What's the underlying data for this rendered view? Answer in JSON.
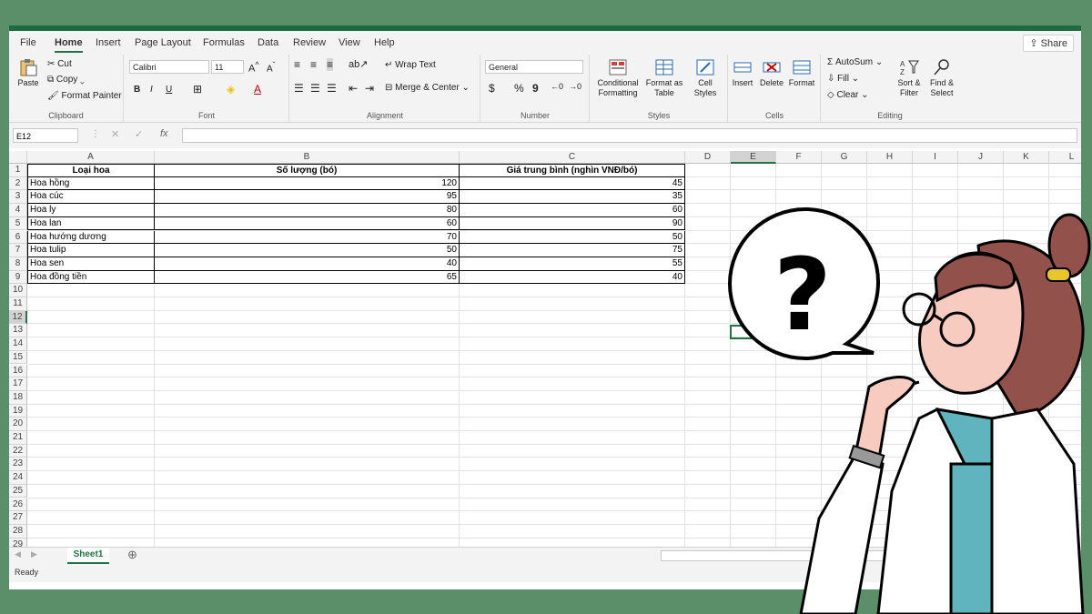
{
  "ribbon_tabs": [
    "File",
    "Home",
    "Insert",
    "Page Layout",
    "Formulas",
    "Data",
    "Review",
    "View",
    "Help"
  ],
  "share_label": "Share",
  "clipboard": {
    "paste": "Paste",
    "cut": "Cut",
    "copy": "Copy",
    "format_painter": "Format Painter",
    "label": "Clipboard"
  },
  "font": {
    "name": "Calibri",
    "size": "11",
    "label": "Font",
    "bold": "B",
    "italic": "I",
    "underline": "U"
  },
  "alignment": {
    "wrap": "Wrap Text",
    "merge": "Merge & Center",
    "label": "Alignment"
  },
  "number": {
    "format": "General",
    "currency": "$",
    "percent": "%",
    "comma": "9",
    "label": "Number"
  },
  "styles": {
    "conditional": "Conditional Formatting",
    "format_table": "Format as Table",
    "cell_styles": "Cell Styles",
    "label": "Styles"
  },
  "cells": {
    "insert": "Insert",
    "delete": "Delete",
    "format": "Format",
    "label": "Cells"
  },
  "editing": {
    "autosum": "AutoSum",
    "fill": "Fill",
    "clear": "Clear",
    "sort": "Sort & Filter",
    "find": "Find & Select",
    "label": "Editing"
  },
  "formula_bar": {
    "name_box": "E12",
    "fx": "fx"
  },
  "columns": [
    "A",
    "B",
    "C",
    "D",
    "E",
    "F",
    "G",
    "H",
    "I",
    "J",
    "K",
    "L"
  ],
  "rows": [
    "1",
    "2",
    "3",
    "4",
    "5",
    "6",
    "7",
    "8",
    "9",
    "10",
    "11",
    "12",
    "13",
    "14",
    "15",
    "16",
    "17",
    "18",
    "19",
    "20",
    "21",
    "22",
    "23",
    "24",
    "25",
    "26",
    "27",
    "28",
    "29"
  ],
  "table": {
    "headers": [
      "Loại hoa",
      "Số lượng (bó)",
      "Giá trung bình (nghìn VNĐ/bó)"
    ],
    "rows": [
      [
        "Hoa hồng",
        "120",
        "45"
      ],
      [
        "Hoa cúc",
        "95",
        "35"
      ],
      [
        "Hoa ly",
        "80",
        "60"
      ],
      [
        "Hoa lan",
        "60",
        "90"
      ],
      [
        "Hoa hướng dương",
        "70",
        "50"
      ],
      [
        "Hoa tulip",
        "50",
        "75"
      ],
      [
        "Hoa sen",
        "40",
        "55"
      ],
      [
        "Hoa đồng tiền",
        "65",
        "40"
      ]
    ]
  },
  "sheet_tab": "Sheet1",
  "status": "Ready",
  "colors": {
    "excel_green": "#217346",
    "background": "#5a8f6a"
  }
}
